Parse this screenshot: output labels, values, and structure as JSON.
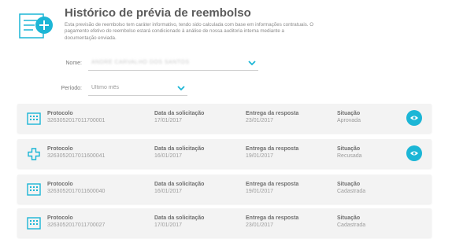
{
  "header": {
    "title": "Histórico de prévia de reembolso",
    "description": "Esta previsão de reembolso tem caráter informativo, tendo sido calculada com base em informações contratuais. O pagamento efetivo do reembolso estará condicionado à análise de nossa auditoria interna mediante a documentação enviada.",
    "icon": "receipt-add-icon"
  },
  "filters": {
    "nome_label": "Nome:",
    "nome_value": "ANDRE CARVALHO DOS SANTOS",
    "periodo_label": "Período:",
    "periodo_value": "Último mês"
  },
  "columns": {
    "protocolo": "Protocolo",
    "data": "Data da solicitação",
    "entrega": "Entrega da resposta",
    "situacao": "Situação"
  },
  "rows": [
    {
      "icon": "building-icon",
      "protocolo": "3263052017011700001",
      "data": "17/01/2017",
      "entrega": "23/01/2017",
      "situacao": "Aprovada",
      "has_view": true
    },
    {
      "icon": "medical-cross-icon",
      "protocolo": "3263052017011600041",
      "data": "16/01/2017",
      "entrega": "19/01/2017",
      "situacao": "Recusada",
      "has_view": true
    },
    {
      "icon": "building-icon",
      "protocolo": "3263052017011600040",
      "data": "16/01/2017",
      "entrega": "19/01/2017",
      "situacao": "Cadastrada",
      "has_view": false
    },
    {
      "icon": "building-icon",
      "protocolo": "3263052017011700027",
      "data": "17/01/2017",
      "entrega": "23/01/2017",
      "situacao": "Cadastrada",
      "has_view": false
    }
  ],
  "colors": {
    "accent": "#1cb6d6",
    "row_bg": "#f3f3f3"
  }
}
